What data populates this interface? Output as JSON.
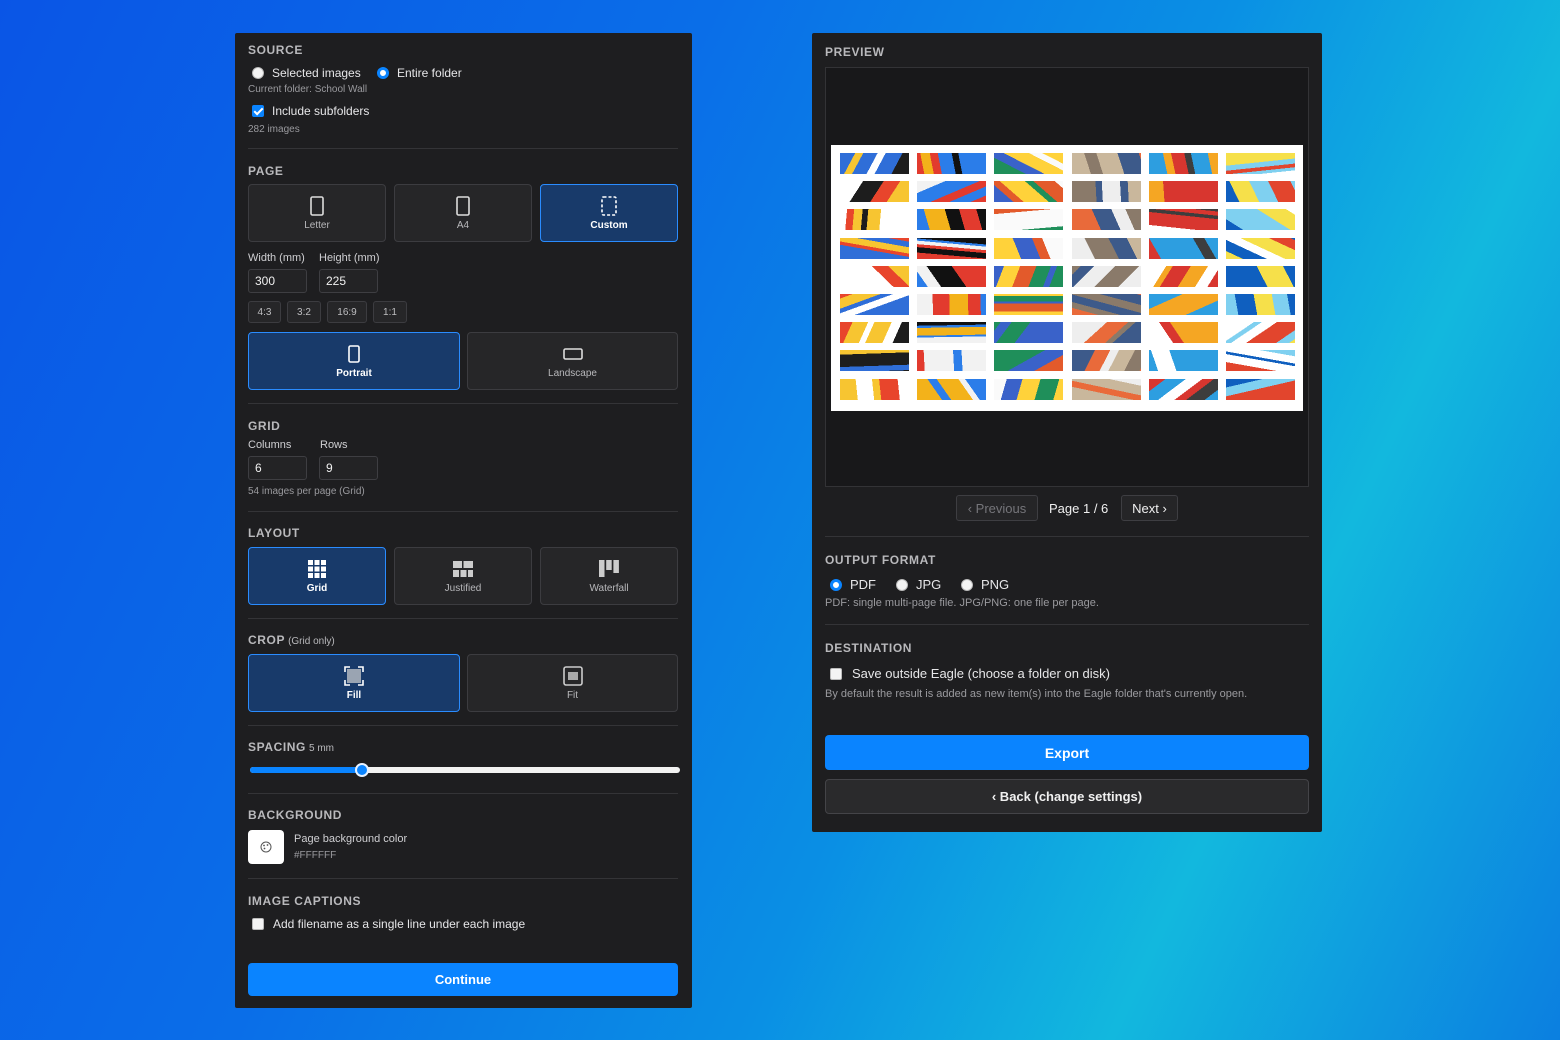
{
  "source": {
    "title": "SOURCE",
    "selected_images": "Selected images",
    "entire_folder": "Entire folder",
    "current_folder": "Current folder: School Wall",
    "include_subfolders": "Include subfolders",
    "image_count": "282 images",
    "mode": "Entire folder",
    "include_subfolders_checked": true
  },
  "page": {
    "title": "PAGE",
    "sizes": [
      {
        "label": "Letter",
        "selected": false
      },
      {
        "label": "A4",
        "selected": false
      },
      {
        "label": "Custom",
        "selected": true
      }
    ],
    "width_label": "Width (mm)",
    "height_label": "Height (mm)",
    "width": "300",
    "height": "225",
    "ratios": [
      "4:3",
      "3:2",
      "16:9",
      "1:1"
    ],
    "orientations": [
      {
        "label": "Portrait",
        "selected": true
      },
      {
        "label": "Landscape",
        "selected": false
      }
    ]
  },
  "grid": {
    "title": "GRID",
    "columns_label": "Columns",
    "rows_label": "Rows",
    "columns": "6",
    "rows": "9",
    "summary": "54 images per page (Grid)"
  },
  "layout": {
    "title": "LAYOUT",
    "options": [
      {
        "label": "Grid",
        "selected": true
      },
      {
        "label": "Justified",
        "selected": false
      },
      {
        "label": "Waterfall",
        "selected": false
      }
    ]
  },
  "crop": {
    "title": "CROP",
    "note": "(Grid only)",
    "options": [
      {
        "label": "Fill",
        "selected": true
      },
      {
        "label": "Fit",
        "selected": false
      }
    ]
  },
  "spacing": {
    "title": "SPACING",
    "value_label": "5 mm",
    "fraction": 0.26
  },
  "background": {
    "title": "BACKGROUND",
    "label": "Page background color",
    "hex": "#FFFFFF"
  },
  "captions": {
    "title": "IMAGE CAPTIONS",
    "label": "Add filename as a single line under each image",
    "checked": false
  },
  "continue_label": "Continue",
  "preview": {
    "title": "PREVIEW",
    "prev_label": "‹ Previous",
    "page_indicator": "Page 1 / 6",
    "next_label": "Next ›",
    "grid_columns": 6,
    "grid_rows": 9
  },
  "output": {
    "title": "OUTPUT FORMAT",
    "options": [
      {
        "label": "PDF",
        "selected": true
      },
      {
        "label": "JPG",
        "selected": false
      },
      {
        "label": "PNG",
        "selected": false
      }
    ],
    "hint": "PDF: single multi-page file. JPG/PNG: one file per page."
  },
  "destination": {
    "title": "DESTINATION",
    "save_outside": "Save outside Eagle (choose a folder on disk)",
    "save_outside_checked": false,
    "hint": "By default the result is added as new item(s) into the Eagle folder that's currently open."
  },
  "export_label": "Export",
  "back_label": "‹ Back (change settings)",
  "colors": {
    "accent": "#0a84ff",
    "panel_bg": "#1e1e20",
    "selected_bg": "#183a6a"
  }
}
